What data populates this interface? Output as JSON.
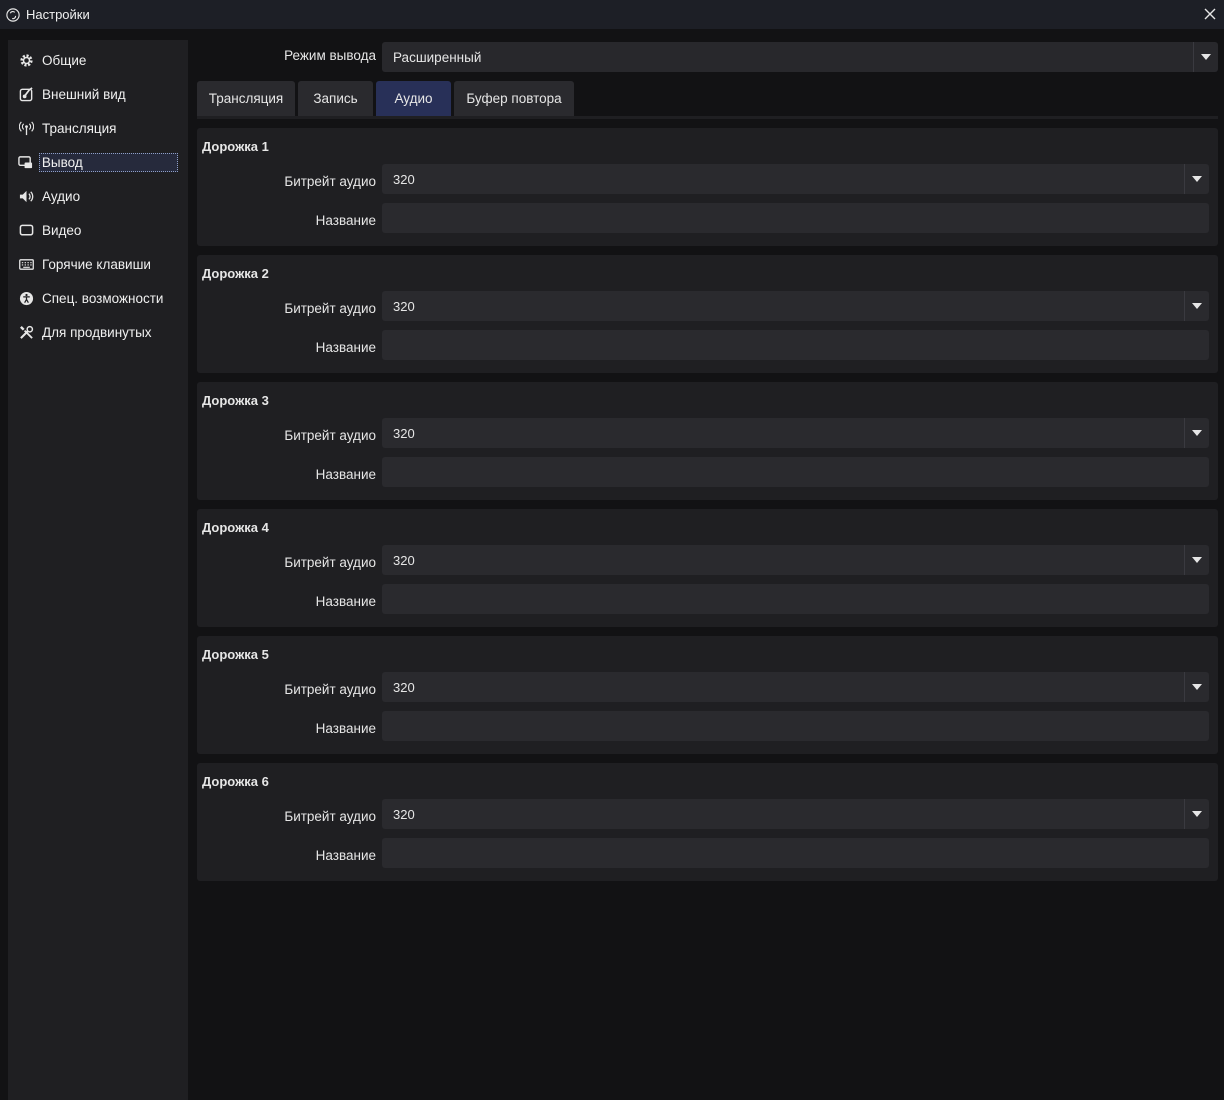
{
  "window": {
    "title": "Настройки"
  },
  "sidebar": {
    "items": [
      {
        "label": "Общие",
        "icon": "gear-icon"
      },
      {
        "label": "Внешний вид",
        "icon": "appearance-icon"
      },
      {
        "label": "Трансляция",
        "icon": "broadcast-icon"
      },
      {
        "label": "Вывод",
        "icon": "output-icon",
        "active": true
      },
      {
        "label": "Аудио",
        "icon": "speaker-icon"
      },
      {
        "label": "Видео",
        "icon": "monitor-icon"
      },
      {
        "label": "Горячие клавиши",
        "icon": "keyboard-icon"
      },
      {
        "label": "Спец. возможности",
        "icon": "accessibility-icon"
      },
      {
        "label": "Для продвинутых",
        "icon": "tools-icon"
      }
    ]
  },
  "output_mode": {
    "label": "Режим вывода",
    "value": "Расширенный"
  },
  "tabs": [
    {
      "label": "Трансляция"
    },
    {
      "label": "Запись"
    },
    {
      "label": "Аудио",
      "active": true
    },
    {
      "label": "Буфер повтора"
    }
  ],
  "tracks": [
    {
      "title": "Дорожка 1",
      "bitrate_label": "Битрейт аудио",
      "bitrate": "320",
      "name_label": "Название",
      "name": ""
    },
    {
      "title": "Дорожка 2",
      "bitrate_label": "Битрейт аудио",
      "bitrate": "320",
      "name_label": "Название",
      "name": ""
    },
    {
      "title": "Дорожка 3",
      "bitrate_label": "Битрейт аудио",
      "bitrate": "320",
      "name_label": "Название",
      "name": ""
    },
    {
      "title": "Дорожка 4",
      "bitrate_label": "Битрейт аудио",
      "bitrate": "320",
      "name_label": "Название",
      "name": ""
    },
    {
      "title": "Дорожка 5",
      "bitrate_label": "Битрейт аудио",
      "bitrate": "320",
      "name_label": "Название",
      "name": ""
    },
    {
      "title": "Дорожка 6",
      "bitrate_label": "Битрейт аудио",
      "bitrate": "320",
      "name_label": "Название",
      "name": ""
    }
  ],
  "colors": {
    "accent_tab": "#283058",
    "background": "#121214",
    "panel": "#1f1f22",
    "field": "#2a2a2e"
  }
}
